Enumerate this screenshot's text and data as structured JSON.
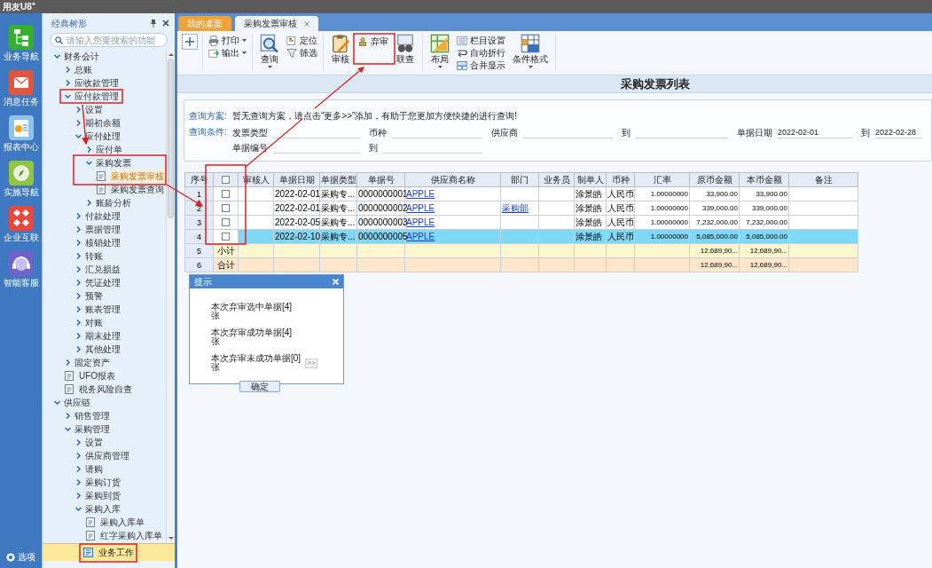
{
  "app_title": "用友U8$^{+}$",
  "nav": {
    "items": [
      {
        "label": "业务导航"
      },
      {
        "label": "消息任务"
      },
      {
        "label": "报表中心"
      },
      {
        "label": "实施导航"
      },
      {
        "label": "企业互联"
      },
      {
        "label": "智能客服"
      }
    ],
    "options_label": "选项"
  },
  "tree_panel": {
    "title": "经典树形",
    "search": {
      "placeholder": "请输入您要搜索的功能"
    },
    "items": [
      {
        "label": "财务会计",
        "kind": "folder",
        "expanded": true,
        "children": [
          {
            "label": "总账",
            "kind": "folder",
            "expanded": false
          },
          {
            "label": "应收款管理",
            "kind": "folder",
            "expanded": false
          },
          {
            "label": "应付款管理",
            "kind": "folder",
            "expanded": true,
            "children": [
              {
                "label": "设置",
                "kind": "folder",
                "expanded": false
              },
              {
                "label": "期初余额",
                "kind": "folder",
                "expanded": false
              },
              {
                "label": "应付处理",
                "kind": "folder",
                "expanded": true,
                "children": [
                  {
                    "label": "应付单",
                    "kind": "folder",
                    "expanded": false
                  },
                  {
                    "label": "采购发票",
                    "kind": "folder",
                    "expanded": true,
                    "children": [
                      {
                        "label": "采购发票审核",
                        "kind": "document",
                        "selected": true
                      },
                      {
                        "label": "采购发票查询",
                        "kind": "document",
                        "selected": false
                      }
                    ]
                  },
                  {
                    "label": "账龄分析",
                    "kind": "folder",
                    "expanded": false
                  }
                ]
              },
              {
                "label": "付款处理",
                "kind": "folder",
                "expanded": false
              },
              {
                "label": "票据管理",
                "kind": "folder",
                "expanded": false
              },
              {
                "label": "核销处理",
                "kind": "folder",
                "expanded": false
              },
              {
                "label": "转账",
                "kind": "folder",
                "expanded": false
              },
              {
                "label": "汇兑损益",
                "kind": "folder",
                "expanded": false
              },
              {
                "label": "凭证处理",
                "kind": "folder",
                "expanded": false
              },
              {
                "label": "预警",
                "kind": "folder",
                "expanded": false
              },
              {
                "label": "账表管理",
                "kind": "folder",
                "expanded": false
              },
              {
                "label": "对账",
                "kind": "folder",
                "expanded": false
              },
              {
                "label": "期末处理",
                "kind": "folder",
                "expanded": false
              },
              {
                "label": "其他处理",
                "kind": "folder",
                "expanded": false
              }
            ]
          },
          {
            "label": "固定资产",
            "kind": "folder",
            "expanded": false
          },
          {
            "label": "UFO报表",
            "kind": "document",
            "selected": false
          },
          {
            "label": "税务风险自查",
            "kind": "document",
            "selected": false
          }
        ]
      },
      {
        "label": "供应链",
        "kind": "folder",
        "expanded": true,
        "children": [
          {
            "label": "销售管理",
            "kind": "folder",
            "expanded": false
          },
          {
            "label": "采购管理",
            "kind": "folder",
            "expanded": true,
            "children": [
              {
                "label": "设置",
                "kind": "folder",
                "expanded": false
              },
              {
                "label": "供应商管理",
                "kind": "folder",
                "expanded": false
              },
              {
                "label": "请购",
                "kind": "folder",
                "expanded": false
              },
              {
                "label": "采购订货",
                "kind": "folder",
                "expanded": false
              },
              {
                "label": "采购到货",
                "kind": "folder",
                "expanded": false
              },
              {
                "label": "采购入库",
                "kind": "folder",
                "expanded": true,
                "children": [
                  {
                    "label": "采购入库单",
                    "kind": "document",
                    "selected": false
                  },
                  {
                    "label": "红字采购入库单",
                    "kind": "document",
                    "selected": false
                  }
                ]
              }
            ]
          }
        ]
      }
    ],
    "bottom_tabs": [
      {
        "label": "业务工作",
        "selected": true
      }
    ]
  },
  "tabs": [
    {
      "label": "我的桌面",
      "selected": false,
      "closable": false
    },
    {
      "label": "采购发票审核",
      "selected": true,
      "closable": true
    }
  ],
  "toolbar": {
    "groups": [
      {
        "items": [
          {
            "label": "打印",
            "kind": "small",
            "dropdown": true
          },
          {
            "label": "输出",
            "kind": "small",
            "dropdown": true
          }
        ]
      },
      {
        "items": [
          {
            "label": "查询",
            "kind": "large",
            "dropdown": true
          },
          {
            "label": "定位",
            "kind": "small",
            "dropdown": false
          },
          {
            "label": "筛选",
            "kind": "small",
            "dropdown": false
          }
        ]
      },
      {
        "items": [
          {
            "label": "审核",
            "kind": "large",
            "dropdown": false
          },
          {
            "label": "弃审",
            "kind": "small",
            "dropdown": false
          },
          {
            "label": "联查",
            "kind": "large",
            "dropdown": false
          }
        ]
      },
      {
        "items": [
          {
            "label": "布局",
            "kind": "large",
            "dropdown": true
          },
          {
            "label": "栏目设置",
            "kind": "small",
            "dropdown": false
          },
          {
            "label": "自动折行",
            "kind": "small",
            "dropdown": false
          },
          {
            "label": "合并显示",
            "kind": "small",
            "dropdown": false
          },
          {
            "label": "条件格式",
            "kind": "large",
            "dropdown": true
          }
        ]
      }
    ]
  },
  "page_title": "采购发票列表",
  "query": {
    "scheme_label": "查询方案:",
    "scheme_text": "暂无查询方案，请点击“更多>>”添加，有助于您更加方便快捷的进行查询!",
    "condition_label": "查询条件:",
    "fields": [
      {
        "label": "发票类型"
      },
      {
        "label": "币种"
      },
      {
        "label": "供应商"
      },
      {
        "label": "到"
      },
      {
        "label": "单据日期",
        "value": "2022-02-01"
      },
      {
        "label": "到",
        "value": "2022-02-28"
      },
      {
        "label": "单据编号"
      },
      {
        "label": "到"
      }
    ]
  },
  "table": {
    "header_checked": false,
    "columns": [
      {
        "label": "序号",
        "kind": "index"
      },
      {
        "kind": "check"
      },
      {
        "label": "审核人",
        "kind": "text"
      },
      {
        "label": "单据日期",
        "kind": "text"
      },
      {
        "label": "单据类型",
        "kind": "text"
      },
      {
        "label": "单据号",
        "kind": "text"
      },
      {
        "label": "供应商名称",
        "kind": "link"
      },
      {
        "label": "部门",
        "kind": "link"
      },
      {
        "label": "业务员",
        "kind": "text"
      },
      {
        "label": "制单人",
        "kind": "text"
      },
      {
        "label": "币种",
        "kind": "text"
      },
      {
        "label": "汇率",
        "kind": "number"
      },
      {
        "label": "原币金额",
        "kind": "number"
      },
      {
        "label": "本币金额",
        "kind": "number"
      },
      {
        "label": "备注",
        "kind": "text"
      }
    ],
    "rows": [
      {
        "kind": "data",
        "selected": false,
        "checked": false,
        "cells": [
          "1",
          null,
          null,
          "2022-02-01",
          "采购专...",
          "0000000001",
          "APPLE",
          null,
          null,
          "涂景皓",
          "人民币",
          "1.00000000",
          "33,900.00",
          "33,900.00",
          null
        ]
      },
      {
        "kind": "data",
        "selected": false,
        "checked": false,
        "cells": [
          "2",
          null,
          null,
          "2022-02-01",
          "采购专...",
          "0000000002",
          "APPLE",
          "采购部",
          null,
          "涂景皓",
          "人民币",
          "1.00000000",
          "339,000.00",
          "339,000.00",
          null
        ]
      },
      {
        "kind": "data",
        "selected": false,
        "checked": false,
        "cells": [
          "3",
          null,
          null,
          "2022-02-05",
          "采购专...",
          "0000000003",
          "APPLE",
          null,
          null,
          "涂景皓",
          "人民币",
          "1.00000000",
          "7,232,000.00",
          "7,232,000.00",
          null
        ]
      },
      {
        "kind": "data",
        "selected": true,
        "checked": false,
        "cells": [
          "4",
          null,
          null,
          "2022-02-10",
          "采购专...",
          "0000000005",
          "APPLE",
          null,
          null,
          "涂景皓",
          "人民币",
          "1.00000000",
          "5,085,000.00",
          "5,085,000.00",
          null
        ]
      },
      {
        "kind": "subtotal",
        "selected": false,
        "cells": [
          "5",
          "小计",
          null,
          null,
          null,
          null,
          null,
          null,
          null,
          null,
          null,
          null,
          "12,689,90...",
          "12,689,90...",
          null
        ]
      },
      {
        "kind": "total",
        "selected": false,
        "cells": [
          "6",
          "合计",
          null,
          null,
          null,
          null,
          null,
          null,
          null,
          null,
          null,
          null,
          "12,689,90...",
          "12,689,90...",
          null
        ]
      }
    ]
  },
  "dialog": {
    "title": "提示",
    "lines": [
      {
        "text": "本次弃审选中单据[4]\n张"
      },
      {
        "text": "本次弃审成功单据[4]\n张"
      },
      {
        "text": "本次弃审未成功单据[0]\n张",
        "more": ">>"
      }
    ],
    "button": "确定"
  }
}
